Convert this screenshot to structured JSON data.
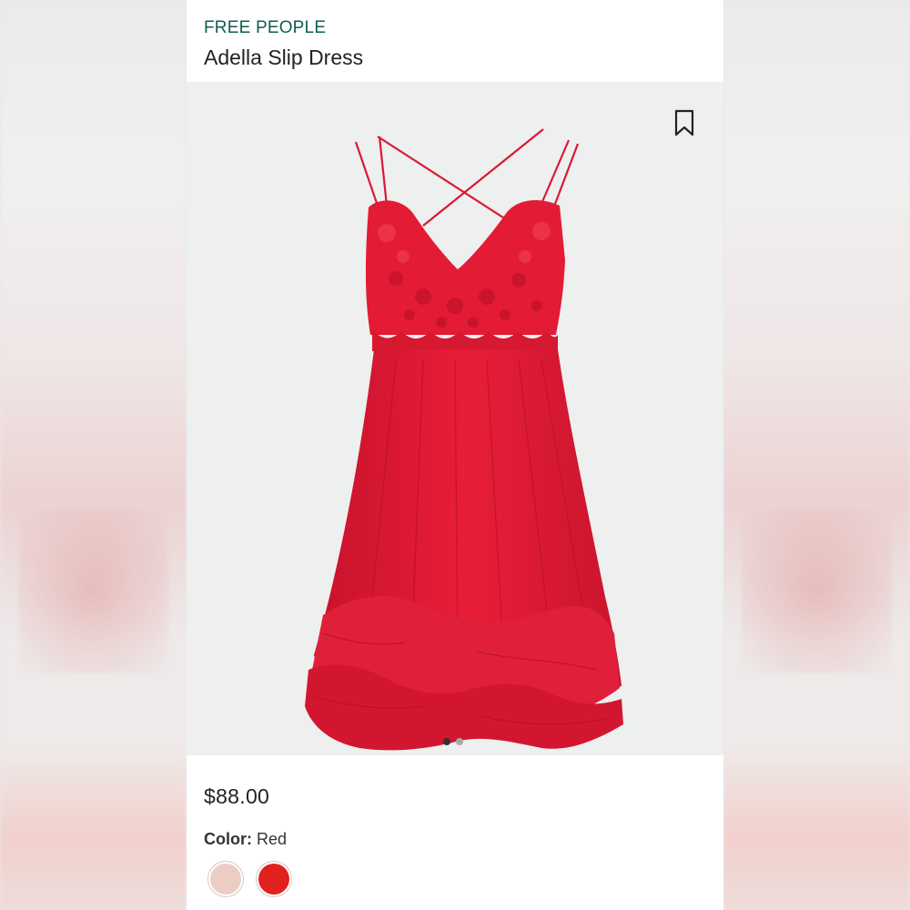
{
  "product": {
    "brand": "FREE PEOPLE",
    "name": "Adella Slip Dress",
    "price": "$88.00",
    "color_label": "Color:",
    "color_value": "Red",
    "swatches": [
      {
        "name": "blush",
        "hex": "#eccdc5"
      },
      {
        "name": "red",
        "hex": "#e2201e"
      }
    ],
    "gallery": {
      "image_count": 2,
      "active_index": 0
    }
  },
  "icons": {
    "bookmark": "bookmark-icon"
  },
  "colors": {
    "brand": "#0f5e4f",
    "dress": "#e41b35"
  }
}
